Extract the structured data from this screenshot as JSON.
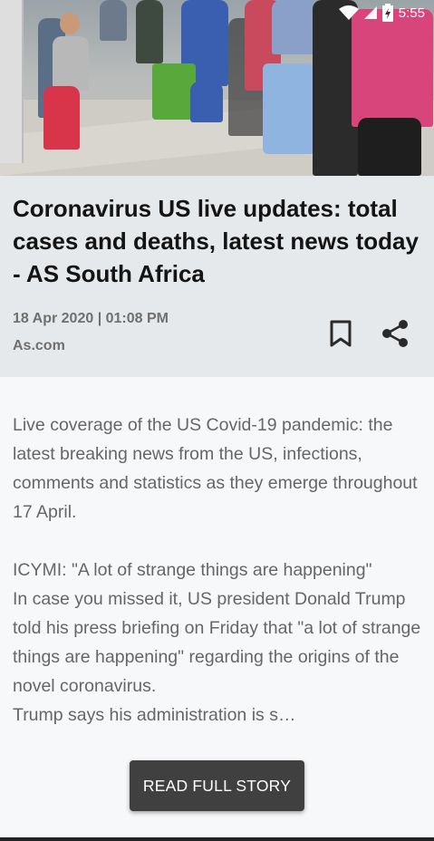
{
  "status_bar": {
    "time": "5:55",
    "icons": [
      "wifi-icon",
      "cell-signal-icon",
      "battery-icon"
    ]
  },
  "hero_image": {
    "alt": "People with shopping carts and bags waiting in a line on a sidewalk"
  },
  "article": {
    "title": "Coronavirus US live updates: total cases and deaths, latest news today - AS South Africa",
    "date": "18 Apr 2020 | 01:08 PM",
    "source": "As.com",
    "paragraph_1": "Live coverage of the US Covid-19 pandemic: the latest breaking news from the US, infections, comments and statistics as they emerge throughout 17 April.",
    "paragraph_2_line_1": "ICYMI: \"A lot of strange things are happening\"",
    "paragraph_2_line_2": "In case you missed it, US president Donald Trump told his press briefing on Friday that \"a lot of strange things are happening\" regarding the origins of the novel coronavirus.",
    "paragraph_2_line_3": "Trump says his administration is s…"
  },
  "actions": {
    "bookmark_icon": "bookmark-icon",
    "share_icon": "share-icon",
    "read_full_story": "READ FULL STORY"
  },
  "colors": {
    "header_bg": "#e6e9eb",
    "page_bg": "#f7f8f9",
    "button_bg": "#404040",
    "title_text": "#141414",
    "meta_text": "#6f6f6f",
    "body_text": "#666666"
  }
}
